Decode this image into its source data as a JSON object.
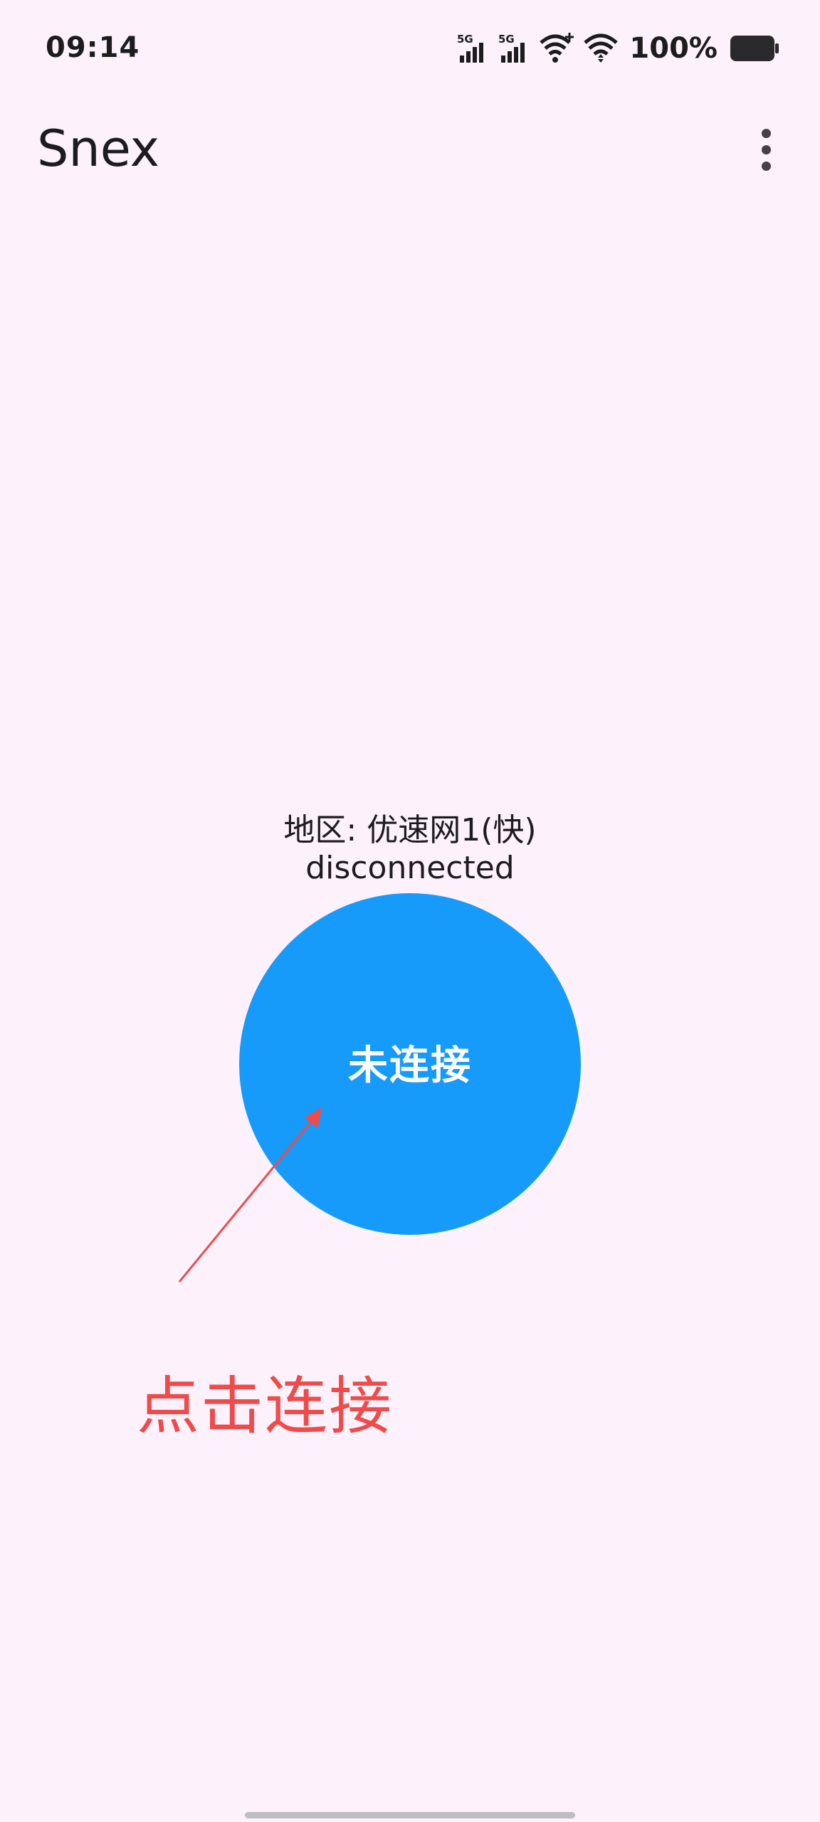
{
  "status_bar": {
    "time": "09:14",
    "network_1": "5G",
    "network_2": "5G",
    "battery": "100%",
    "icons": [
      "signal-5g-icon",
      "signal-5g-icon",
      "wifi-plus-icon",
      "wifi-icon",
      "battery-icon"
    ]
  },
  "app_bar": {
    "title": "Snex",
    "menu_icon": "more-vert-icon"
  },
  "main": {
    "region": "地区: 优速网1(快)",
    "connection_status": "disconnected",
    "connect_button_label": "未连接",
    "button_color": "#169bfb"
  },
  "annotation": {
    "text": "点击连接",
    "color": "#ef4b4b"
  }
}
